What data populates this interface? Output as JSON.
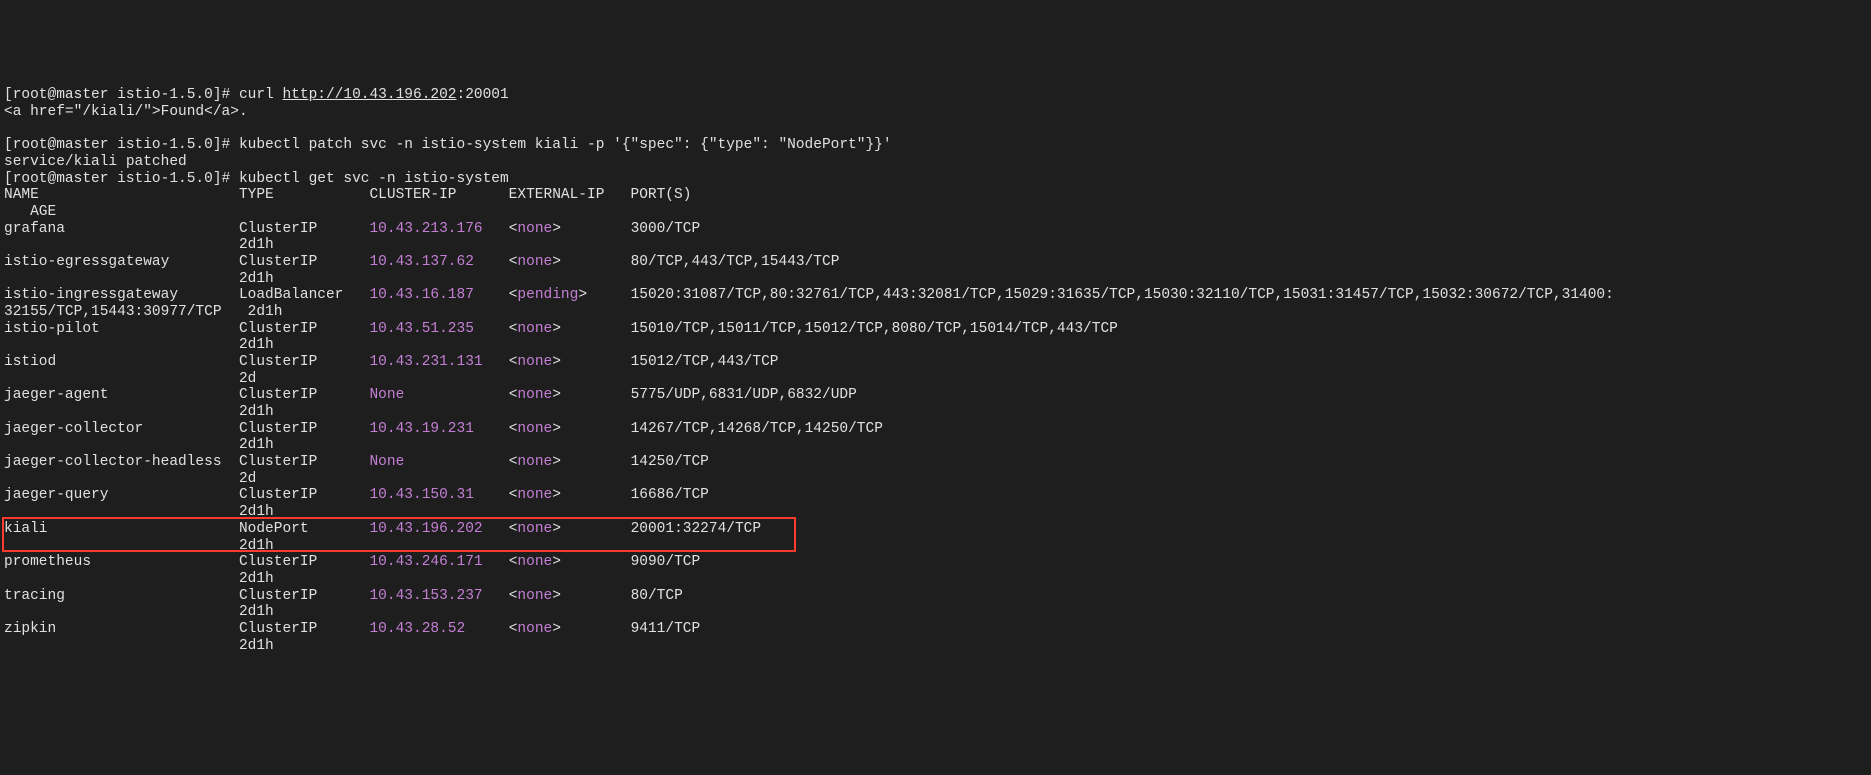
{
  "line1_prompt": "[root@master istio-1.5.0]# ",
  "line1_cmd": "curl ",
  "line1_url": "http://10.43.196.202",
  "line1_port": ":20001",
  "line2": "<a href=\"/kiali/\">Found</a>.",
  "blank": " ",
  "line3_prompt": "[root@master istio-1.5.0]# ",
  "line3_cmd": "kubectl patch svc -n istio-system kiali -p '{\"spec\": {\"type\": \"NodePort\"}}'",
  "line4": "service/kiali patched",
  "line5_prompt": "[root@master istio-1.5.0]# ",
  "line5_cmd": "kubectl get svc -n istio-system",
  "header1": "NAME                       TYPE           CLUSTER-IP      EXTERNAL-IP   PORT(S)",
  "header2": "   AGE",
  "overflow_row": "32155/TCP,15443:30977/TCP   2d1h",
  "services": [
    {
      "name": "grafana",
      "type": "ClusterIP",
      "ip": "10.43.213.176",
      "ext": "<none>",
      "ports": "3000/TCP",
      "age": "2d1h",
      "ip_none": false
    },
    {
      "name": "istio-egressgateway",
      "type": "ClusterIP",
      "ip": "10.43.137.62",
      "ext": "<none>",
      "ports": "80/TCP,443/TCP,15443/TCP",
      "age": "2d1h",
      "ip_none": false
    },
    {
      "name": "istio-ingressgateway",
      "type": "LoadBalancer",
      "ip": "10.43.16.187",
      "ext": "<pending>",
      "ports": "15020:31087/TCP,80:32761/TCP,443:32081/TCP,15029:31635/TCP,15030:32110/TCP,15031:31457/TCP,15032:30672/TCP,31400:",
      "age": "",
      "ip_none": false
    },
    {
      "name": "istio-pilot",
      "type": "ClusterIP",
      "ip": "10.43.51.235",
      "ext": "<none>",
      "ports": "15010/TCP,15011/TCP,15012/TCP,8080/TCP,15014/TCP,443/TCP",
      "age": "2d1h",
      "ip_none": false
    },
    {
      "name": "istiod",
      "type": "ClusterIP",
      "ip": "10.43.231.131",
      "ext": "<none>",
      "ports": "15012/TCP,443/TCP",
      "age": "2d",
      "ip_none": false
    },
    {
      "name": "jaeger-agent",
      "type": "ClusterIP",
      "ip": "None",
      "ext": "<none>",
      "ports": "5775/UDP,6831/UDP,6832/UDP",
      "age": "2d1h",
      "ip_none": true
    },
    {
      "name": "jaeger-collector",
      "type": "ClusterIP",
      "ip": "10.43.19.231",
      "ext": "<none>",
      "ports": "14267/TCP,14268/TCP,14250/TCP",
      "age": "2d1h",
      "ip_none": false
    },
    {
      "name": "jaeger-collector-headless",
      "type": "ClusterIP",
      "ip": "None",
      "ext": "<none>",
      "ports": "14250/TCP",
      "age": "2d",
      "ip_none": true
    },
    {
      "name": "jaeger-query",
      "type": "ClusterIP",
      "ip": "10.43.150.31",
      "ext": "<none>",
      "ports": "16686/TCP",
      "age": "2d1h",
      "ip_none": false
    },
    {
      "name": "kiali",
      "type": "NodePort",
      "ip": "10.43.196.202",
      "ext": "<none>",
      "ports": "20001:32274/TCP",
      "age": "2d1h",
      "ip_none": false,
      "highlight": true
    },
    {
      "name": "prometheus",
      "type": "ClusterIP",
      "ip": "10.43.246.171",
      "ext": "<none>",
      "ports": "9090/TCP",
      "age": "2d1h",
      "ip_none": false
    },
    {
      "name": "tracing",
      "type": "ClusterIP",
      "ip": "10.43.153.237",
      "ext": "<none>",
      "ports": "80/TCP",
      "age": "2d1h",
      "ip_none": false
    },
    {
      "name": "zipkin",
      "type": "ClusterIP",
      "ip": "10.43.28.52",
      "ext": "<none>",
      "ports": "9411/TCP",
      "age": "2d1h",
      "ip_none": false
    }
  ],
  "cols": {
    "name": 27,
    "type": 15,
    "ip": 16,
    "ext": 14
  }
}
